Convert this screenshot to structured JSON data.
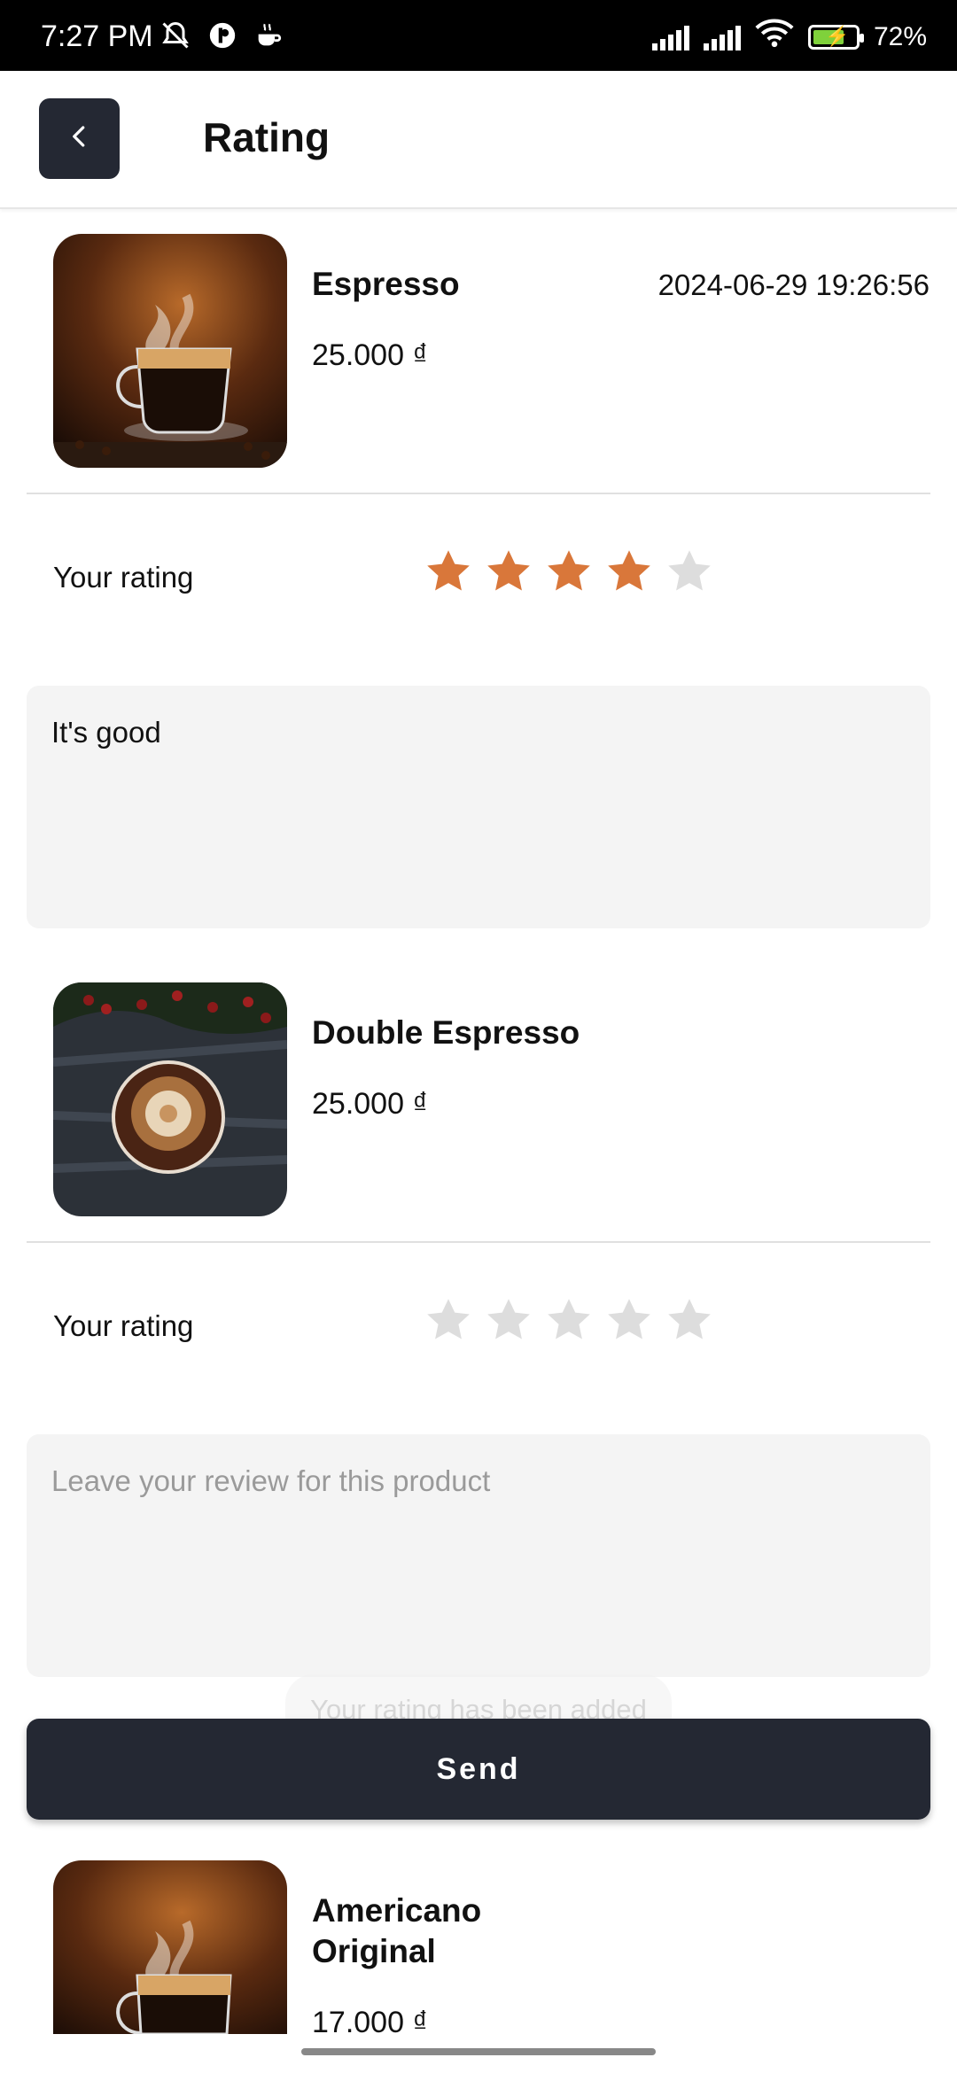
{
  "status_bar": {
    "time": "7:27 PM",
    "battery": "72%"
  },
  "header": {
    "title": "Rating"
  },
  "products": [
    {
      "name": "Espresso",
      "price": "25.000 ₫",
      "date": "2024-06-29 19:26:56",
      "rating_label": "Your rating",
      "rating": 4,
      "review_value": "It's good",
      "review_placeholder": "Leave your review for this product"
    },
    {
      "name": "Double Espresso",
      "price": "25.000 ₫",
      "date": "",
      "rating_label": "Your rating",
      "rating": 0,
      "review_value": "",
      "review_placeholder": "Leave your review for this product"
    },
    {
      "name": "Americano Original",
      "price": "17.000 ₫"
    }
  ],
  "toast": "Your rating has been added",
  "send_button": "Send",
  "colors": {
    "star_active": "#D9773A",
    "star_inactive": "#DDDDDD",
    "button_bg": "#242833"
  }
}
